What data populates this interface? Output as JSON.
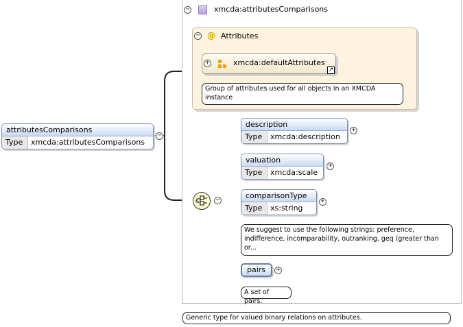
{
  "complex_type": {
    "name": "xmcda:attributesComparisons",
    "annotation": "Generic type for valued binary relations on attributes."
  },
  "attributes_group": {
    "title": "Attributes",
    "ref_name": "xmcda:defaultAttributes",
    "ref_annotation": "Group of attributes used for all objects in an XMCDA instance"
  },
  "root_element": {
    "name": "attributesComparisons",
    "type_key": "Type",
    "type_value": "xmcda:attributesComparisons"
  },
  "children": [
    {
      "name": "description",
      "type_key": "Type",
      "type_value": "xmcda:description"
    },
    {
      "name": "valuation",
      "type_key": "Type",
      "type_value": "xmcda:scale"
    },
    {
      "name": "comparisonType",
      "type_key": "Type",
      "type_value": "xs:string",
      "annotation": "We suggest to use the following strings: preference, indifference, incomparability, outranking, geq (greater than or..."
    },
    {
      "name": "pairs",
      "annotation": "A set of pairs."
    }
  ],
  "colors": {
    "group_bg": "#fdf3de",
    "element_header": "#c9daf3",
    "sequence_fill": "#fffbc8"
  },
  "icons": {
    "collapse": "minus-circle",
    "expand": "plus-circle",
    "complex_type": "complex-type-icon",
    "attribute_group": "attribute-group-icon",
    "sequence": "sequence-icon",
    "link": "link-arrow-icon"
  }
}
